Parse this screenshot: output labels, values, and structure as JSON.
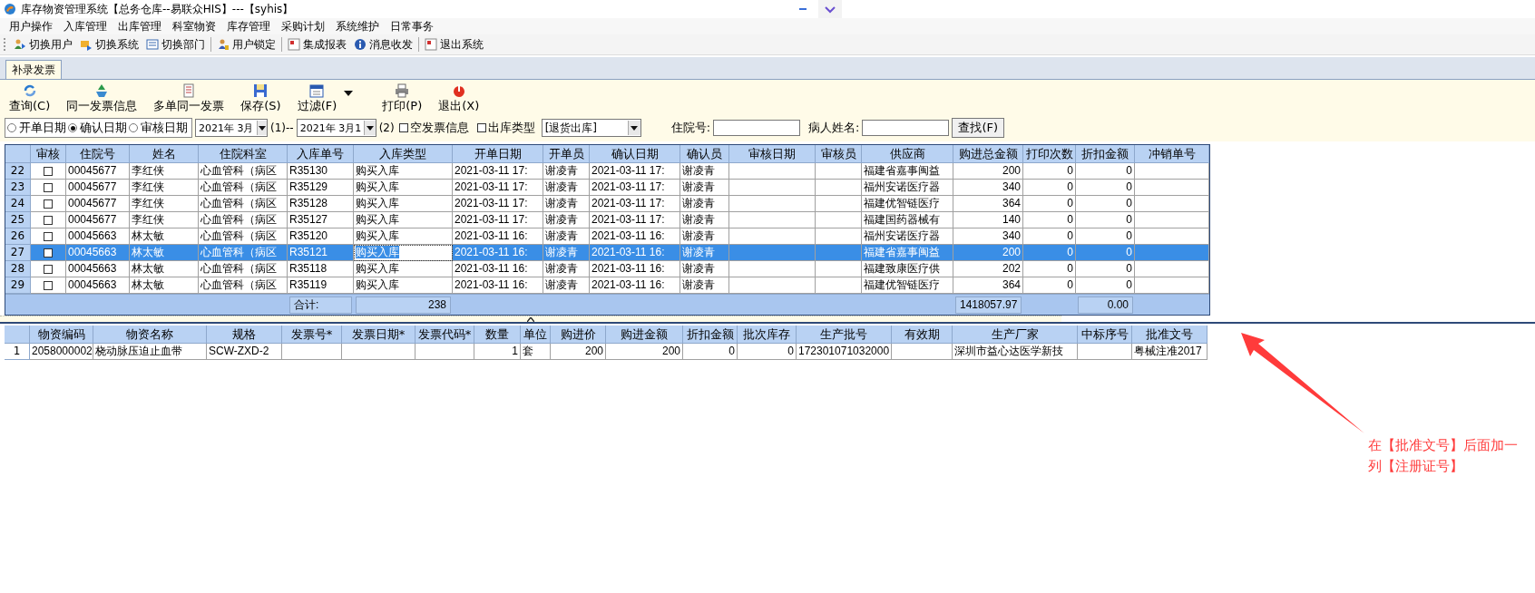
{
  "window": {
    "title": "库存物资管理系统【总务仓库--易联众HIS】---【syhis】"
  },
  "menu": [
    "用户操作",
    "入库管理",
    "出库管理",
    "科室物资",
    "库存管理",
    "采购计划",
    "系统维护",
    "日常事务"
  ],
  "toolbar": [
    [
      "切换用户",
      "切换系统",
      "切换部门"
    ],
    [
      "用户锁定"
    ],
    [
      "集成报表",
      "消息收发"
    ],
    [
      "退出系统"
    ]
  ],
  "tabs": [
    {
      "label": "补录发票",
      "selected": true
    }
  ],
  "actions": [
    {
      "label": "查询(C)",
      "kind": "button"
    },
    {
      "label": "同一发票信息",
      "kind": "button"
    },
    {
      "label": "多单同一发票",
      "kind": "button"
    },
    {
      "label": "保存(S)",
      "kind": "button"
    },
    {
      "label": "过滤(F)",
      "kind": "split"
    },
    {
      "label": "打印(P)",
      "kind": "button"
    },
    {
      "label": "退出(X)",
      "kind": "button"
    }
  ],
  "filter": {
    "date_modes": [
      {
        "label": "开单日期",
        "selected": false
      },
      {
        "label": "确认日期",
        "selected": true
      },
      {
        "label": "审核日期",
        "selected": false
      }
    ],
    "from": "2021年 3月",
    "from_mark": "(1)--",
    "to": "2021年 3月1",
    "to_mark": "(2)",
    "empty_invoice": {
      "label": "空发票信息",
      "checked": false
    },
    "out_type": {
      "label": "出库类型",
      "checked": false,
      "value": "[退货出库]"
    },
    "inpatient_label": "住院号:",
    "patient_label": "病人姓名:",
    "search_button": "查找(F)"
  },
  "upper_table": {
    "columns": [
      "审核",
      "住院号",
      "姓名",
      "住院科室",
      "入库单号",
      "入库类型",
      "开单日期",
      "开单员",
      "确认日期",
      "确认员",
      "审核日期",
      "审核员",
      "供应商",
      "购进总金额",
      "打印次数",
      "折扣金额",
      "冲销单号"
    ],
    "rows": [
      {
        "num": "22",
        "checked": false,
        "selected": false,
        "cell_focused": false,
        "cells": [
          "",
          "00045677",
          "李红侠",
          "心血管科（病区",
          "R35130",
          "购买入库",
          "2021-03-11 17:",
          "谢凌青",
          "2021-03-11 17:",
          "谢凌青",
          "",
          "",
          "福建省嘉事闽益",
          "200",
          "0",
          "0",
          ""
        ]
      },
      {
        "num": "23",
        "checked": false,
        "selected": false,
        "cell_focused": false,
        "cells": [
          "",
          "00045677",
          "李红侠",
          "心血管科（病区",
          "R35129",
          "购买入库",
          "2021-03-11 17:",
          "谢凌青",
          "2021-03-11 17:",
          "谢凌青",
          "",
          "",
          "福州安诺医疗器",
          "340",
          "0",
          "0",
          ""
        ]
      },
      {
        "num": "24",
        "checked": false,
        "selected": false,
        "cell_focused": false,
        "cells": [
          "",
          "00045677",
          "李红侠",
          "心血管科（病区",
          "R35128",
          "购买入库",
          "2021-03-11 17:",
          "谢凌青",
          "2021-03-11 17:",
          "谢凌青",
          "",
          "",
          "福建优智链医疗",
          "364",
          "0",
          "0",
          ""
        ]
      },
      {
        "num": "25",
        "checked": false,
        "selected": false,
        "cell_focused": false,
        "cells": [
          "",
          "00045677",
          "李红侠",
          "心血管科（病区",
          "R35127",
          "购买入库",
          "2021-03-11 17:",
          "谢凌青",
          "2021-03-11 17:",
          "谢凌青",
          "",
          "",
          "福建国药器械有",
          "140",
          "0",
          "0",
          ""
        ]
      },
      {
        "num": "26",
        "checked": false,
        "selected": false,
        "cell_focused": false,
        "cells": [
          "",
          "00045663",
          "林太敏",
          "心血管科（病区",
          "R35120",
          "购买入库",
          "2021-03-11 16:",
          "谢凌青",
          "2021-03-11 16:",
          "谢凌青",
          "",
          "",
          "福州安诺医疗器",
          "340",
          "0",
          "0",
          ""
        ]
      },
      {
        "num": "27",
        "checked": false,
        "selected": true,
        "cell_focused": true,
        "cells": [
          "",
          "00045663",
          "林太敏",
          "心血管科（病区",
          "R35121",
          "购买入库",
          "2021-03-11 16:",
          "谢凌青",
          "2021-03-11 16:",
          "谢凌青",
          "",
          "",
          "福建省嘉事闽益",
          "200",
          "0",
          "0",
          ""
        ]
      },
      {
        "num": "28",
        "checked": false,
        "selected": false,
        "cell_focused": false,
        "cells": [
          "",
          "00045663",
          "林太敏",
          "心血管科（病区",
          "R35118",
          "购买入库",
          "2021-03-11 16:",
          "谢凌青",
          "2021-03-11 16:",
          "谢凌青",
          "",
          "",
          "福建致康医疗供",
          "202",
          "0",
          "0",
          ""
        ]
      },
      {
        "num": "29",
        "checked": false,
        "selected": false,
        "cell_focused": false,
        "cells": [
          "",
          "00045663",
          "林太敏",
          "心血管科（病区",
          "R35119",
          "购买入库",
          "2021-03-11 16:",
          "谢凌青",
          "2021-03-11 16:",
          "谢凌青",
          "",
          "",
          "福建优智链医疗",
          "364",
          "0",
          "0",
          ""
        ]
      }
    ],
    "footer": {
      "label": "合计:",
      "count": "238",
      "total_amount": "1418057.97",
      "total_discount": "0.00"
    }
  },
  "lower_table": {
    "columns": [
      "物资编码",
      "物资名称",
      "规格",
      "发票号*",
      "发票日期*",
      "发票代码*",
      "数量",
      "单位",
      "购进价",
      "购进金额",
      "折扣金额",
      "批次库存",
      "生产批号",
      "有效期",
      "生产厂家",
      "中标序号",
      "批准文号"
    ],
    "rows": [
      {
        "num": "1",
        "cells": [
          "2058000002",
          "桡动脉压迫止血带",
          "SCW-ZXD-2",
          "",
          "",
          "",
          "1",
          "套",
          "200",
          "200",
          "0",
          "0",
          "172301071032000",
          "",
          "深圳市益心达医学新技",
          "",
          "粤械注准2017"
        ]
      }
    ]
  },
  "annotation": {
    "text": "在【批准文号】后面加一列【注册证号】",
    "color": "#ff3b3b"
  }
}
